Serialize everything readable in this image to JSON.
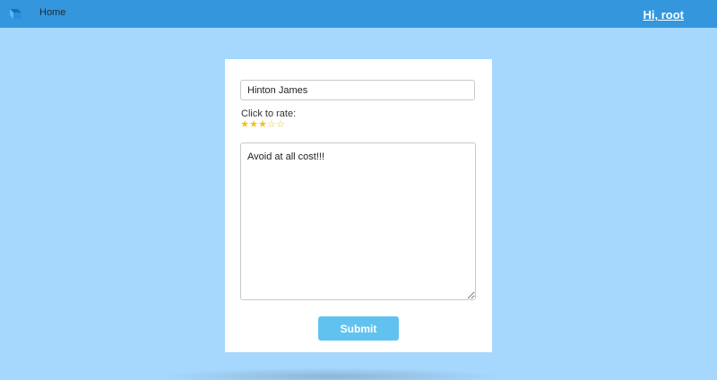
{
  "navbar": {
    "logo_icon": "app-logo-icon",
    "home_label": "Home",
    "user_greeting": "Hi, root",
    "background_color": "#3497de"
  },
  "form": {
    "name_value": "Hinton James",
    "rate_label": "Click to rate:",
    "rating": 3,
    "rating_max": 5,
    "review_value": "Avoid at all cost!!!",
    "submit_label": "Submit",
    "submit_color": "#62c2ef"
  },
  "page": {
    "background_color": "#a6d8fd"
  }
}
